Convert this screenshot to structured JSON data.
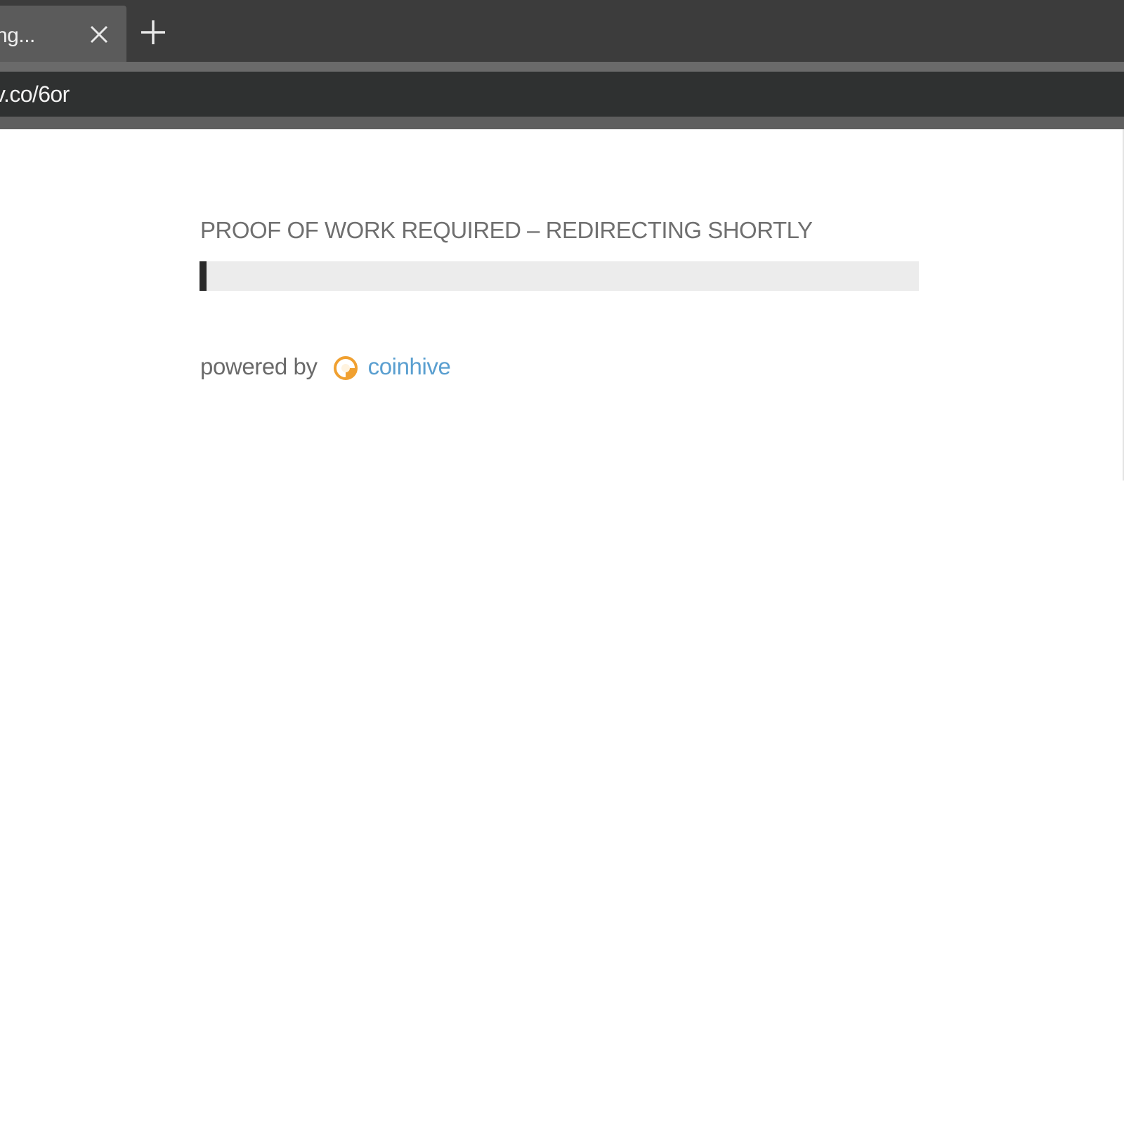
{
  "browser": {
    "tab": {
      "title": "ng...",
      "close_icon": "close-icon"
    },
    "new_tab_icon": "plus-icon",
    "address_bar": {
      "url": "v.co/6or"
    },
    "colors": {
      "tabbar_bg": "#3c3c3c",
      "active_tab_bg": "#5b5b5b",
      "address_bar_bg": "#2f3131"
    }
  },
  "page": {
    "heading": "PROOF OF WORK REQUIRED – REDIRECTING SHORTLY",
    "progress": {
      "fraction": 0.01,
      "track_color": "#ececec",
      "fill_color": "#2a2a2a"
    },
    "powered_by": {
      "label": "powered by",
      "logo_icon": "coinhive-logo-icon",
      "brand": "coinhive",
      "brand_color": "#5a9fd0",
      "logo_color": "#f0a030"
    }
  }
}
